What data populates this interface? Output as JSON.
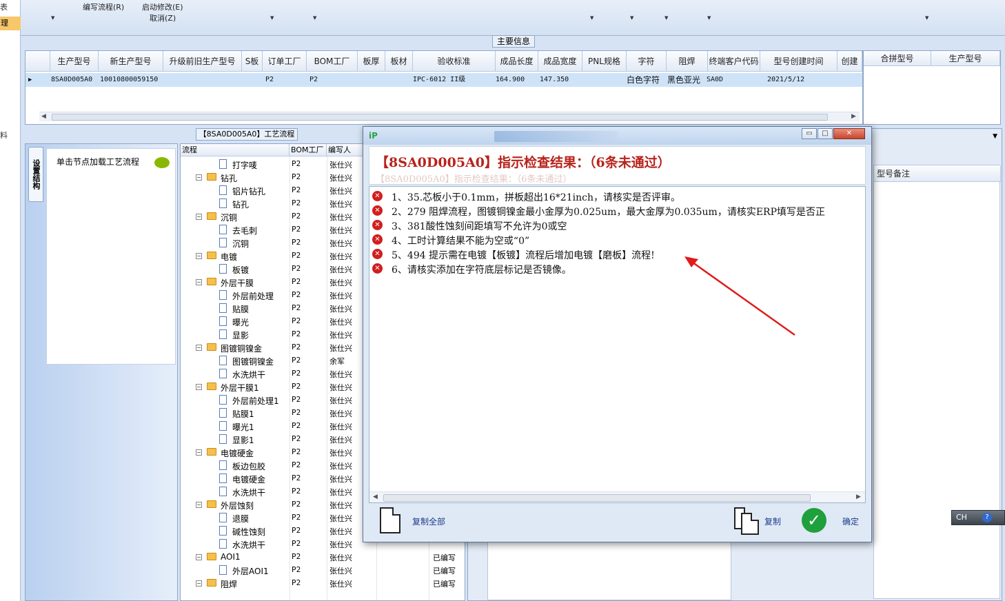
{
  "left_strip": {
    "items": [
      "表",
      "理",
      "料"
    ]
  },
  "ribbon": {
    "buttons": [
      {
        "label": "编写流程(R)"
      },
      {
        "label": "启动修改(E)"
      },
      {
        "label": "取消(Z)"
      }
    ]
  },
  "main_info": {
    "title": "主要信息",
    "columns": [
      "生产型号",
      "新生产型号",
      "升级前旧生产型号",
      "S板",
      "订单工厂",
      "BOM工厂",
      "板厚",
      "板材",
      "验收标准",
      "成品长度",
      "成品宽度",
      "PNL规格",
      "字符",
      "阻焊",
      "终端客户代码",
      "型号创建时间",
      "创建"
    ],
    "row": [
      "8SA0D005A0",
      "10010800059150",
      "",
      "",
      "P2",
      "P2",
      "",
      "",
      "IPC-6012 II级",
      "164.900",
      "147.350",
      "",
      "白色字符",
      "黑色亚光",
      "SA0D",
      "2021/5/12",
      ""
    ],
    "side_columns": [
      "合拼型号",
      "生产型号"
    ]
  },
  "process": {
    "title": "【8SA0D005A0】工艺流程",
    "vertical_tab": "设置结构",
    "hint": "单击节点加载工艺流程",
    "tree_headers": [
      "流程",
      "BOM工厂",
      "编写人"
    ],
    "rows": [
      {
        "name": "打字唛",
        "level": 2,
        "bom": "P2",
        "writer": "张仕兴",
        "status": ""
      },
      {
        "name": "钻孔",
        "level": 1,
        "bom": "P2",
        "writer": "张仕兴",
        "status": ""
      },
      {
        "name": "铝片钻孔",
        "level": 2,
        "bom": "P2",
        "writer": "张仕兴",
        "status": ""
      },
      {
        "name": "钻孔",
        "level": 2,
        "bom": "P2",
        "writer": "张仕兴",
        "status": ""
      },
      {
        "name": "沉铜",
        "level": 1,
        "bom": "P2",
        "writer": "张仕兴",
        "status": ""
      },
      {
        "name": "去毛刺",
        "level": 2,
        "bom": "P2",
        "writer": "张仕兴",
        "status": ""
      },
      {
        "name": "沉铜",
        "level": 2,
        "bom": "P2",
        "writer": "张仕兴",
        "status": ""
      },
      {
        "name": "电镀",
        "level": 1,
        "bom": "P2",
        "writer": "张仕兴",
        "status": ""
      },
      {
        "name": "板镀",
        "level": 2,
        "bom": "P2",
        "writer": "张仕兴",
        "status": ""
      },
      {
        "name": "外层干膜",
        "level": 1,
        "bom": "P2",
        "writer": "张仕兴",
        "status": ""
      },
      {
        "name": "外层前处理",
        "level": 2,
        "bom": "P2",
        "writer": "张仕兴",
        "status": ""
      },
      {
        "name": "贴膜",
        "level": 2,
        "bom": "P2",
        "writer": "张仕兴",
        "status": ""
      },
      {
        "name": "曝光",
        "level": 2,
        "bom": "P2",
        "writer": "张仕兴",
        "status": ""
      },
      {
        "name": "显影",
        "level": 2,
        "bom": "P2",
        "writer": "张仕兴",
        "status": ""
      },
      {
        "name": "图镀铜镍金",
        "level": 1,
        "bom": "P2",
        "writer": "张仕兴",
        "status": ""
      },
      {
        "name": "图镀铜镍金",
        "level": 2,
        "bom": "P2",
        "writer": "余军",
        "status": ""
      },
      {
        "name": "水洗烘干",
        "level": 2,
        "bom": "P2",
        "writer": "张仕兴",
        "status": ""
      },
      {
        "name": "外层干膜1",
        "level": 1,
        "bom": "P2",
        "writer": "张仕兴",
        "status": ""
      },
      {
        "name": "外层前处理1",
        "level": 2,
        "bom": "P2",
        "writer": "张仕兴",
        "status": ""
      },
      {
        "name": "贴膜1",
        "level": 2,
        "bom": "P2",
        "writer": "张仕兴",
        "status": ""
      },
      {
        "name": "曝光1",
        "level": 2,
        "bom": "P2",
        "writer": "张仕兴",
        "status": ""
      },
      {
        "name": "显影1",
        "level": 2,
        "bom": "P2",
        "writer": "张仕兴",
        "status": ""
      },
      {
        "name": "电镀硬金",
        "level": 1,
        "bom": "P2",
        "writer": "张仕兴",
        "status": ""
      },
      {
        "name": "板边包胶",
        "level": 2,
        "bom": "P2",
        "writer": "张仕兴",
        "status": ""
      },
      {
        "name": "电镀硬金",
        "level": 2,
        "bom": "P2",
        "writer": "张仕兴",
        "status": ""
      },
      {
        "name": "水洗烘干",
        "level": 2,
        "bom": "P2",
        "writer": "张仕兴",
        "status": ""
      },
      {
        "name": "外层蚀刻",
        "level": 1,
        "bom": "P2",
        "writer": "张仕兴",
        "status": ""
      },
      {
        "name": "退膜",
        "level": 2,
        "bom": "P2",
        "writer": "张仕兴",
        "status": ""
      },
      {
        "name": "碱性蚀刻",
        "level": 2,
        "bom": "P2",
        "writer": "张仕兴",
        "status": ""
      },
      {
        "name": "水洗烘干",
        "level": 2,
        "bom": "P2",
        "writer": "张仕兴",
        "status": ""
      },
      {
        "name": "AOI1",
        "level": 1,
        "bom": "P2",
        "writer": "张仕兴",
        "status": "已编写"
      },
      {
        "name": "外层AOI1",
        "level": 2,
        "bom": "P2",
        "writer": "张仕兴",
        "status": "已编写"
      },
      {
        "name": "阻焊",
        "level": 1,
        "bom": "P2",
        "writer": "张仕兴",
        "status": "已编写"
      }
    ]
  },
  "model_remark": {
    "title": "型号备注"
  },
  "dialog": {
    "logo": "iP",
    "min": "▭",
    "max": "□",
    "close": "✕",
    "heading": "【8SA0D005A0】指示检查结果：（6条未通过）",
    "heading_reflection": "【8SA0D005A0】指示检查结果：（6条未通过）",
    "messages": [
      "1、35.芯板小于0.1mm，拼板超出16*21inch，请核实是否评审。",
      "2、279 阻焊流程，图镀铜镍金最小金厚为0.025um，最大金厚为0.035um，请核实ERP填写是否正",
      "3、381酸性蚀刻间距填写不允许为0或空",
      "4、工时计算结果不能为空或“0”",
      "5、494 提示需在电镀【板镀】流程后增加电镀【磨板】流程!",
      "6、请核实添加在字符底层标记是否镜像。"
    ],
    "copy_all_label": "复制全部",
    "copy_label": "复制",
    "ok_label": "确定"
  },
  "ime": {
    "label": "CH",
    "help": "?"
  },
  "colors": {
    "error_red": "#d21e1e",
    "heading_red": "#b8231c",
    "arrow_red": "#e01b1b",
    "selected_row": "#cfe3f8"
  }
}
